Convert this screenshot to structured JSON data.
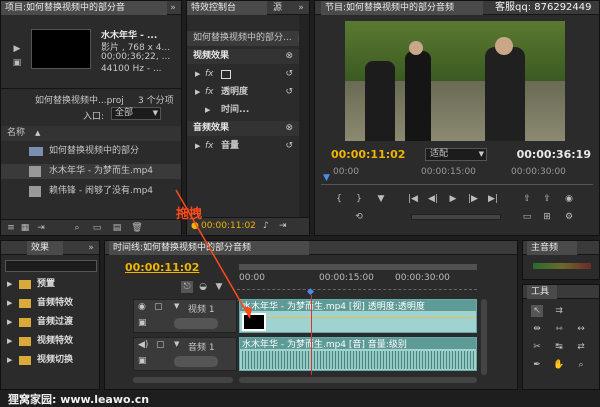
{
  "project": {
    "tab_label": "项目:如何替换视频中的部分音",
    "clip_title": "水木年华 - ...",
    "clip_type": "影片 , 768 x 4...",
    "clip_duration": "00;00;36;22, ...",
    "clip_audio": "44100 Hz - ...",
    "project_name": "如何替换视频中...proj",
    "item_count": "3 个分项",
    "entry_label": "入口:",
    "entry_value": "全部",
    "column_name": "名称",
    "items": [
      {
        "label": "如何替换视频中的部分"
      },
      {
        "label": "水木年华 - 为梦而生.mp4"
      },
      {
        "label": "赖伟锋 - 闹够了没有.mp4"
      }
    ]
  },
  "effect_controls": {
    "tab_label": "特效控制台",
    "tab_source": "源",
    "header": "如何替换视频中的部分...",
    "video_effects": "视频效果",
    "motion": "",
    "opacity": "透明度",
    "time": "时间...",
    "audio_effects": "音频效果",
    "volume": "音量",
    "timecode": "00:00:11:02"
  },
  "program": {
    "tab_label": "节目:如何替换视频中的部分音频",
    "watermark": "客服qq: 876292449",
    "current_time": "00:00:11:02",
    "fit_value": "适配",
    "duration": "00:00:36:19",
    "ruler": [
      "00:00",
      "00:00:15:00",
      "00:00:30:00"
    ]
  },
  "annotation": {
    "drag_label": "拖拽"
  },
  "effects_panel": {
    "tab_label": "效果",
    "items": [
      {
        "label": "预置"
      },
      {
        "label": "音频特效"
      },
      {
        "label": "音频过渡"
      },
      {
        "label": "视频特效"
      },
      {
        "label": "视频切换"
      }
    ]
  },
  "timeline": {
    "tab_label": "时间线:如何替换视频中的部分音频",
    "timecode": "00:00:11:02",
    "ruler": [
      "00:00",
      "00:00:15:00",
      "00:00:30:00"
    ],
    "video_track_label": "视频 1",
    "audio_track_label": "音频 1",
    "video_clip_label": "水木年华 - 为梦而生.mp4 [视] 透明度:透明度",
    "audio_clip_label": "水木年华 - 为梦而生.mp4 [音] 音量:级别"
  },
  "audio_master": {
    "tab_label": "主音频"
  },
  "tools": {
    "tab_label": "工具"
  },
  "footer": {
    "watermark": "狸窝家园: www.leawo.cn"
  },
  "colors": {
    "accent_time": "#f0b400",
    "playhead": "#e03030",
    "video_clip": "#9fd3cf",
    "audio_clip": "#9fd3cf",
    "annotation_red": "#ff4a1c"
  }
}
